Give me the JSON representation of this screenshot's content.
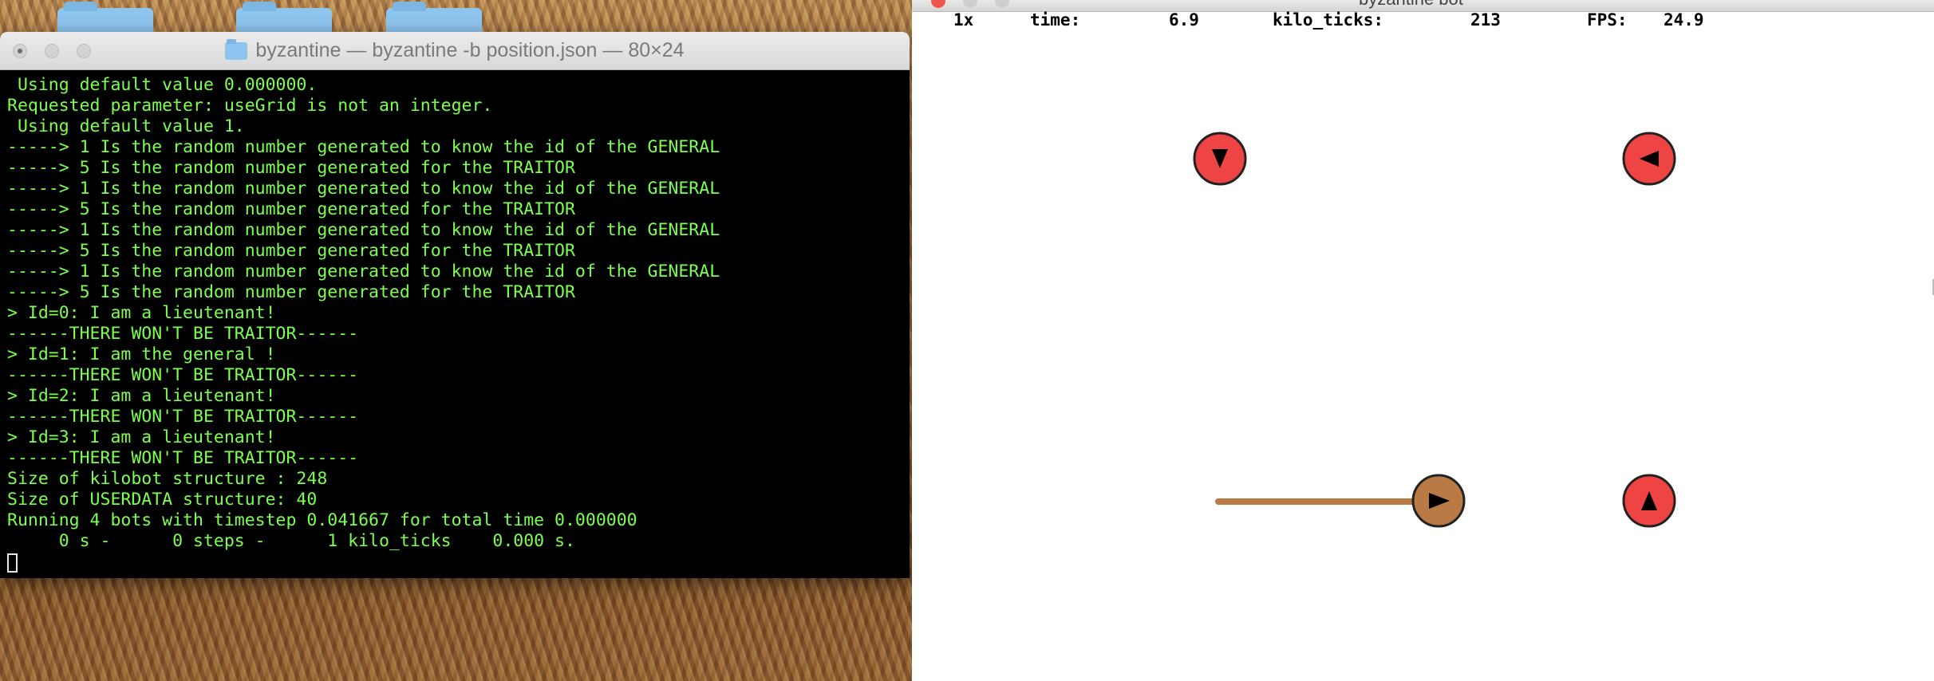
{
  "terminal": {
    "title": "byzantine — byzantine -b position.json — 80×24",
    "lines": [
      " Using default value 0.000000.",
      "Requested parameter: useGrid is not an integer.",
      " Using default value 1.",
      "-----> 1 Is the random number generated to know the id of the GENERAL",
      "-----> 5 Is the random number generated for the TRAITOR",
      "-----> 1 Is the random number generated to know the id of the GENERAL",
      "-----> 5 Is the random number generated for the TRAITOR",
      "-----> 1 Is the random number generated to know the id of the GENERAL",
      "-----> 5 Is the random number generated for the TRAITOR",
      "-----> 1 Is the random number generated to know the id of the GENERAL",
      "-----> 5 Is the random number generated for the TRAITOR",
      "> Id=0: I am a lieutenant!",
      "------THERE WON'T BE TRAITOR------",
      "> Id=1: I am the general !",
      "------THERE WON'T BE TRAITOR------",
      "> Id=2: I am a lieutenant!",
      "------THERE WON'T BE TRAITOR------",
      "> Id=3: I am a lieutenant!",
      "------THERE WON'T BE TRAITOR------",
      "Size of kilobot structure : 248",
      "Size of USERDATA structure: 40",
      "Running 4 bots with timestep 0.041667 for total time 0.000000",
      "     0 s -      0 steps -      1 kilo_ticks    0.000 s."
    ],
    "text_color": "#7cff4e",
    "background": "#000000"
  },
  "simulator": {
    "title": "byzantine bot",
    "hud": {
      "speed": "1x",
      "time_label": "time:",
      "time_value": "6.9",
      "kilo_ticks_label": "kilo_ticks:",
      "kilo_ticks_value": "213",
      "fps_label": "FPS:",
      "fps_value": "24.9"
    },
    "bots": [
      {
        "name": "bot-top-left",
        "color": "#ef4444",
        "heading": "down"
      },
      {
        "name": "bot-top-right",
        "color": "#ef4444",
        "heading": "left"
      },
      {
        "name": "bot-bottom-left",
        "color": "#b97a45",
        "heading": "right"
      },
      {
        "name": "bot-bottom-right",
        "color": "#ef4444",
        "heading": "up"
      }
    ],
    "trail_color": "#b97a45"
  }
}
